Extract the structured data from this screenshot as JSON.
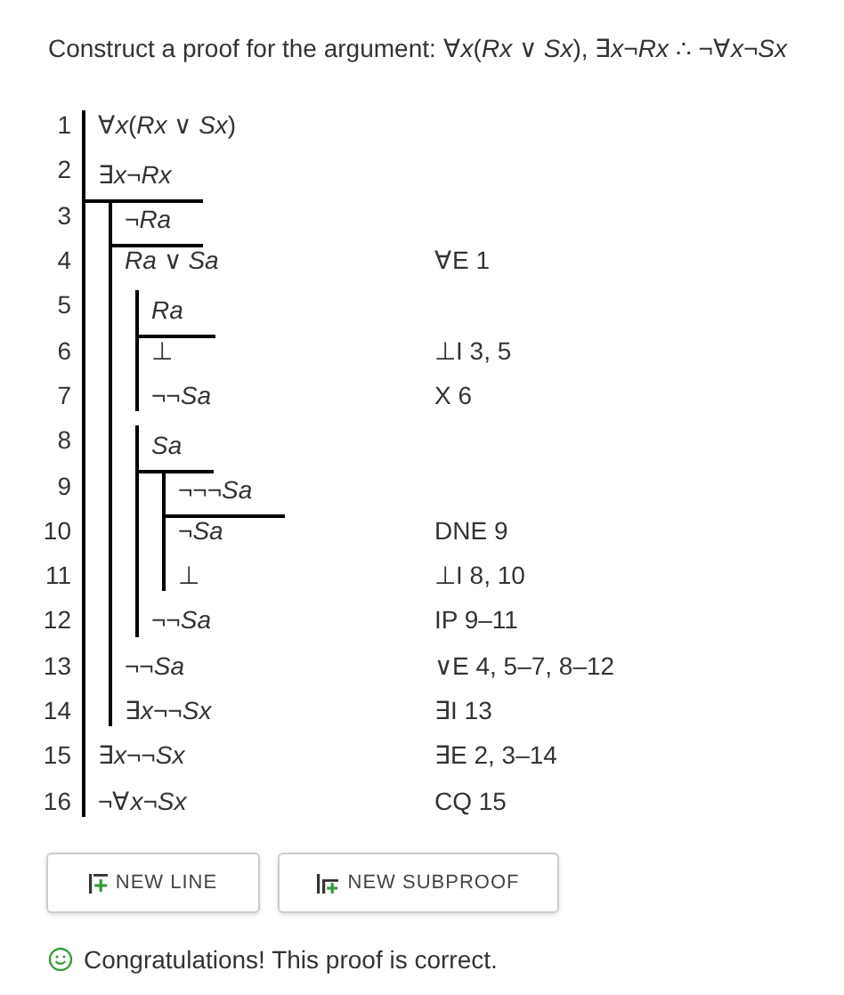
{
  "prompt": "Construct a proof for the argument: ∀*x*(*Rx* ∨ *Sx*), ∃*x*¬*Rx* ∴ ¬∀*x*¬*Sx*",
  "proof": {
    "assumptions": [
      {
        "number": "1",
        "formula": "∀*x*(*Rx* ∨ *Sx*)"
      },
      {
        "number": "2",
        "formula": "∃*x*¬*Rx*"
      }
    ],
    "body": [
      {
        "kind": "subproof",
        "assumptions": [
          {
            "number": "3",
            "formula": "¬*Ra*"
          }
        ],
        "body": [
          {
            "kind": "line",
            "number": "4",
            "formula": "*Ra* ∨ *Sa*",
            "justification": "∀E 1"
          },
          {
            "kind": "subproof",
            "assumptions": [
              {
                "number": "5",
                "formula": "*Ra*"
              }
            ],
            "body": [
              {
                "kind": "line",
                "number": "6",
                "formula": "⊥",
                "justification": "⊥I 3, 5"
              },
              {
                "kind": "line",
                "number": "7",
                "formula": "¬¬*Sa*",
                "justification": "X 6"
              }
            ]
          },
          {
            "kind": "subproof",
            "assumptions": [
              {
                "number": "8",
                "formula": "*Sa*"
              }
            ],
            "body": [
              {
                "kind": "subproof",
                "assumptions": [
                  {
                    "number": "9",
                    "formula": "¬¬¬*Sa*"
                  }
                ],
                "body": [
                  {
                    "kind": "line",
                    "number": "10",
                    "formula": "¬*Sa*",
                    "justification": "DNE 9"
                  },
                  {
                    "kind": "line",
                    "number": "11",
                    "formula": "⊥",
                    "justification": "⊥I 8, 10"
                  }
                ]
              },
              {
                "kind": "line",
                "number": "12",
                "formula": "¬¬*Sa*",
                "justification": "IP 9–11"
              }
            ]
          },
          {
            "kind": "line",
            "number": "13",
            "formula": "¬¬*Sa*",
            "justification": "∨E 4, 5–7, 8–12"
          },
          {
            "kind": "line",
            "number": "14",
            "formula": "∃*x*¬¬*Sx*",
            "justification": "∃I 13"
          }
        ]
      },
      {
        "kind": "line",
        "number": "15",
        "formula": "∃*x*¬¬*Sx*",
        "justification": "∃E 2, 3–14"
      },
      {
        "kind": "line",
        "number": "16",
        "formula": "¬∀*x*¬*Sx*",
        "justification": "CQ 15"
      }
    ]
  },
  "buttons": [
    {
      "kind": "line",
      "label": "NEW LINE"
    },
    {
      "kind": "subproof",
      "label": "NEW SUBPROOF"
    }
  ],
  "message": {
    "kind": "success",
    "text": "Congratulations! This proof is correct."
  }
}
